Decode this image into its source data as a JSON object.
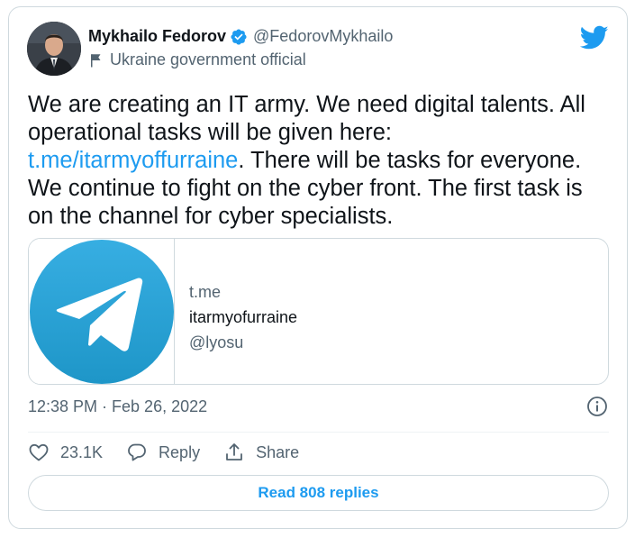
{
  "author": {
    "display_name": "Mykhailo Fedorov",
    "handle": "@FedorovMykhailo",
    "label": "Ukraine government official",
    "verified": true
  },
  "tweet": {
    "text_before_link": "We are creating an IT army. We need digital talents. All operational tasks will be given here: ",
    "link_text": "t.me/itarmyoffurraine",
    "text_after_link": ". There will be tasks for everyone. We continue to fight on the cyber front. The first task is on the channel for cyber specialists."
  },
  "link_card": {
    "domain": "t.me",
    "title": "itarmyofurraine",
    "description": "@lyosu"
  },
  "meta": {
    "timestamp": "12:38 PM · Feb 26, 2022"
  },
  "actions": {
    "likes": "23.1K",
    "reply_label": "Reply",
    "share_label": "Share"
  },
  "replies_button": "Read 808 replies",
  "colors": {
    "accent": "#1d9bf0",
    "text": "#0f1419",
    "muted": "#536471",
    "border": "#cfd9de"
  },
  "icons": [
    "avatar",
    "verified-badge-icon",
    "flag-icon",
    "twitter-bird-icon",
    "telegram-logo-icon",
    "info-icon",
    "heart-icon",
    "reply-bubble-icon",
    "share-icon"
  ]
}
